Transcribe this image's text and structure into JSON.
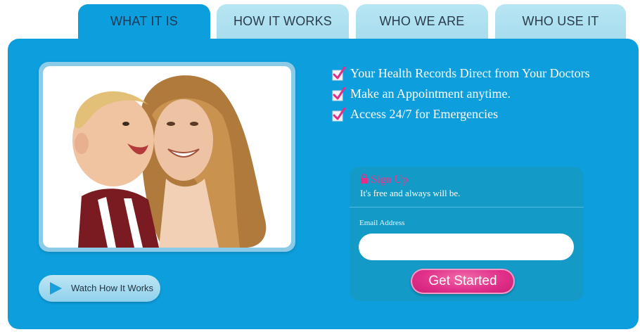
{
  "tabs": [
    {
      "label": "WHAT IT IS",
      "active": true
    },
    {
      "label": "HOW IT WORKS",
      "active": false
    },
    {
      "label": "WHO WE ARE",
      "active": false
    },
    {
      "label": "WHO USE IT",
      "active": false
    }
  ],
  "features": [
    "Your Health Records Direct from Your Doctors",
    "Make an Appointment anytime.",
    "Access 24/7 for Emergencies"
  ],
  "signup": {
    "title": "Sign Up",
    "subtitle": "It's free and always will be.",
    "email_label": "Email Address",
    "email_value": "",
    "submit_label": "Get Started"
  },
  "watch_button": {
    "label": "Watch How It Works",
    "icon": "play-icon"
  },
  "icons": {
    "check": "checkbox-checked-icon",
    "lock": "lock-icon"
  },
  "colors": {
    "panel": "#0d9fdd",
    "tab_inactive": "#b8e6f3",
    "accent_pink": "#e0308a",
    "signup_card": "#139ac7"
  }
}
